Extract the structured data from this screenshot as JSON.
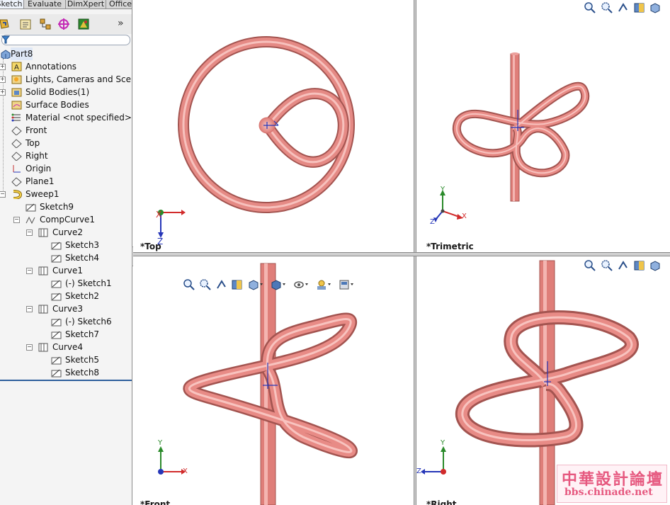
{
  "tabs": [
    "Sketch",
    "Evaluate",
    "DimXpert",
    "Office Products"
  ],
  "active_tab": "Sketch",
  "feature_tree": {
    "root": "Part8",
    "items": [
      {
        "label": "Annotations",
        "icon": "annotations-icon"
      },
      {
        "label": "Lights, Cameras and Scene",
        "icon": "lights-icon"
      },
      {
        "label": "Solid Bodies(1)",
        "icon": "solid-bodies-icon"
      },
      {
        "label": "Surface Bodies",
        "icon": "surface-bodies-icon"
      },
      {
        "label": "Material <not specified>",
        "icon": "material-icon"
      },
      {
        "label": "Front",
        "icon": "plane-icon"
      },
      {
        "label": "Top",
        "icon": "plane-icon"
      },
      {
        "label": "Right",
        "icon": "plane-icon"
      },
      {
        "label": "Origin",
        "icon": "origin-icon"
      },
      {
        "label": "Plane1",
        "icon": "plane-icon"
      },
      {
        "label": "Sweep1",
        "icon": "sweep-icon"
      },
      {
        "label": "Sketch9",
        "icon": "sketch-icon"
      },
      {
        "label": "CompCurve1",
        "icon": "composite-curve-icon"
      },
      {
        "label": "Curve2",
        "icon": "curve-icon"
      },
      {
        "label": "Sketch3",
        "icon": "sketch-icon"
      },
      {
        "label": "Sketch4",
        "icon": "sketch-icon"
      },
      {
        "label": "Curve1",
        "icon": "curve-icon"
      },
      {
        "label": "(-) Sketch1",
        "icon": "sketch-icon"
      },
      {
        "label": "Sketch2",
        "icon": "sketch-icon"
      },
      {
        "label": "Curve3",
        "icon": "curve-icon"
      },
      {
        "label": "(-) Sketch6",
        "icon": "sketch-icon"
      },
      {
        "label": "Sketch7",
        "icon": "sketch-icon"
      },
      {
        "label": "Curve4",
        "icon": "curve-icon"
      },
      {
        "label": "Sketch5",
        "icon": "sketch-icon"
      },
      {
        "label": "Sketch8",
        "icon": "sketch-icon"
      }
    ]
  },
  "viewports": {
    "top": {
      "label": "*Top",
      "axes": [
        "X",
        "Z"
      ]
    },
    "trimetric": {
      "label": "*Trimetric",
      "axes": [
        "Y",
        "X",
        "Z"
      ]
    },
    "front": {
      "label": "*Front",
      "axes": [
        "Y",
        "X"
      ]
    },
    "right": {
      "label": "*Right",
      "axes": [
        "Y",
        "Z"
      ]
    }
  },
  "watermark": {
    "line1": "中華設計論壇",
    "line2": "bbs.chinade.net"
  },
  "colors": {
    "tube": "#e0807c",
    "tube_dark": "#9c4a47",
    "axis_x": "#d12b2b",
    "axis_y": "#2a8a2a",
    "axis_z": "#2636b8",
    "selection": "#dfe8f6"
  }
}
